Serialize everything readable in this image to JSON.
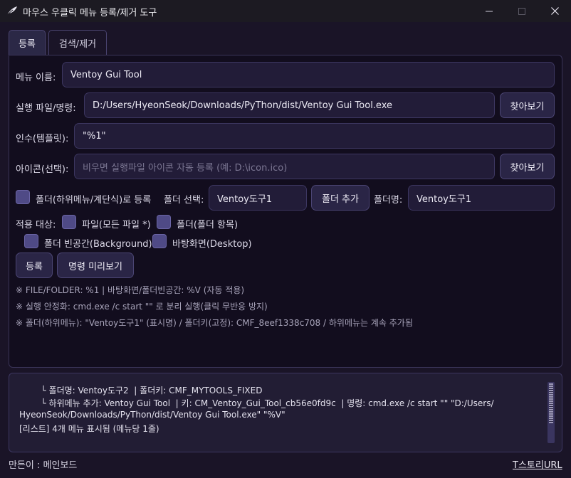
{
  "window": {
    "title": "마우스 우클릭 메뉴 등록/제거 도구",
    "app_icon": "feather-icon",
    "minimize_icon": "minimize-icon",
    "maximize_icon": "maximize-icon",
    "close_icon": "close-icon"
  },
  "tabs": [
    {
      "label": "등록",
      "active": true
    },
    {
      "label": "검색/제거",
      "active": false
    }
  ],
  "form": {
    "menu_name_label": "메뉴 이름:",
    "menu_name_value": "Ventoy Gui Tool",
    "exec_label": "실행 파일/명령:",
    "exec_value": "D:/Users/HyeonSeok/Downloads/PyThon/dist/Ventoy Gui Tool.exe",
    "browse_exec_label": "찾아보기",
    "args_label": "인수(템플릿):",
    "args_value": "\"%1\"",
    "icon_label": "아이콘(선택):",
    "icon_placeholder": "비우면 실행파일 아이콘 자동 등록 (예: D:\\icon.ico)",
    "browse_icon_label": "찾아보기",
    "folder_checkbox_label": "폴더(하위메뉴/계단식)로 등록",
    "folder_select_label": "폴더 선택:",
    "folder_select_value": "Ventoy도구1",
    "add_folder_label": "폴더 추가",
    "folder_name_label": "폴더명:",
    "folder_name_value": "Ventoy도구1",
    "target_label": "적용 대상:",
    "target_file_label": "파일(모든 파일 *)",
    "target_folder_label": "폴더(폴더 항목)",
    "target_background_label": "폴더 빈공간(Background)",
    "target_desktop_label": "바탕화면(Desktop)",
    "register_label": "등록",
    "preview_label": "명령 미리보기"
  },
  "notes": [
    "※ FILE/FOLDER: %1 | 바탕화면/폴더빈공간: %V (자동 적용)",
    "※ 실행 안정화: cmd.exe /c start \"\" 로 분리 실행(클릭 무반응 방지)",
    "※ 폴더(하위메뉴): \"Ventoy도구1\" (표시명) / 폴더키(고정): CMF_8eef1338c708 / 하위메뉴는 계속 추가됨"
  ],
  "log": {
    "lines": [
      "        └ 폴더명: Ventoy도구2  | 폴더키: CMF_MYTOOLS_FIXED",
      "        └ 하위메뉴 추가: Ventoy Gui Tool  | 키: CM_Ventoy_Gui_Tool_cb56e0fd9c  | 명령: cmd.exe /c start \"\" \"D:/Users/",
      "HyeonSeok/Downloads/PyThon/dist/Ventoy Gui Tool.exe\" \"%V\"",
      "[리스트] 4개 메뉴 표시됨 (메뉴당 1줄)"
    ]
  },
  "footer": {
    "author": "만든이 : 메인보드",
    "link": "T스토리URL"
  },
  "colors": {
    "background": "#1a1427",
    "panel": "#120d1e",
    "input": "#221c38",
    "checkbox": "#4f4a86",
    "button": "#2a2546"
  }
}
